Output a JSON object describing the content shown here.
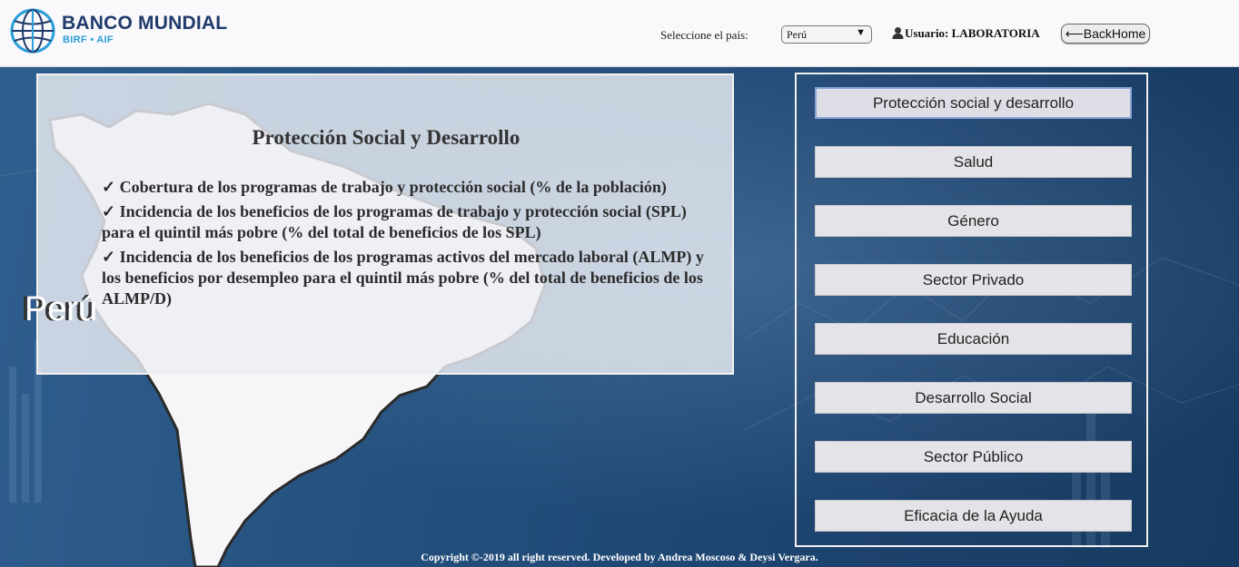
{
  "header": {
    "logo_name": "BANCO MUNDIAL",
    "logo_sub": "BIRF • AIF",
    "country_label": "Seleccione el país:",
    "country_value": "Perú",
    "user_label": "Usuario: LABORATORIA",
    "backhome_label": "BackHome"
  },
  "info": {
    "title": "Protección Social y Desarrollo",
    "items": [
      "✓ Cobertura de los programas de trabajo y protección social (% de la población)",
      "✓ Incidencia de los beneficios de los programas de trabajo y protección social (SPL) para el quintil más pobre (% del total de beneficios de los SPL)",
      "✓ Incidencia de los beneficios de los programas activos del mercado laboral (ALMP) y los beneficios por desempleo para el quintil más pobre (% del total de beneficios de los ALMP/D)"
    ]
  },
  "country_overlay": "Perú",
  "nav": [
    "Protección social y desarrollo",
    "Salud",
    "Género",
    "Sector Privado",
    "Educación",
    "Desarrollo Social",
    "Sector Público",
    "Eficacia de la Ayuda"
  ],
  "footer": "Copyright ©-2019 all right reserved. Developed by Andrea Moscoso & Deysi Vergara.",
  "colors": {
    "brand_blue": "#1f3a6b",
    "brand_light_blue": "#2a9fd8",
    "background_blue": "#24507e"
  },
  "icons": [
    "globe-logo-icon",
    "user-icon",
    "dropdown-arrow-icon",
    "back-arrow-icon"
  ]
}
